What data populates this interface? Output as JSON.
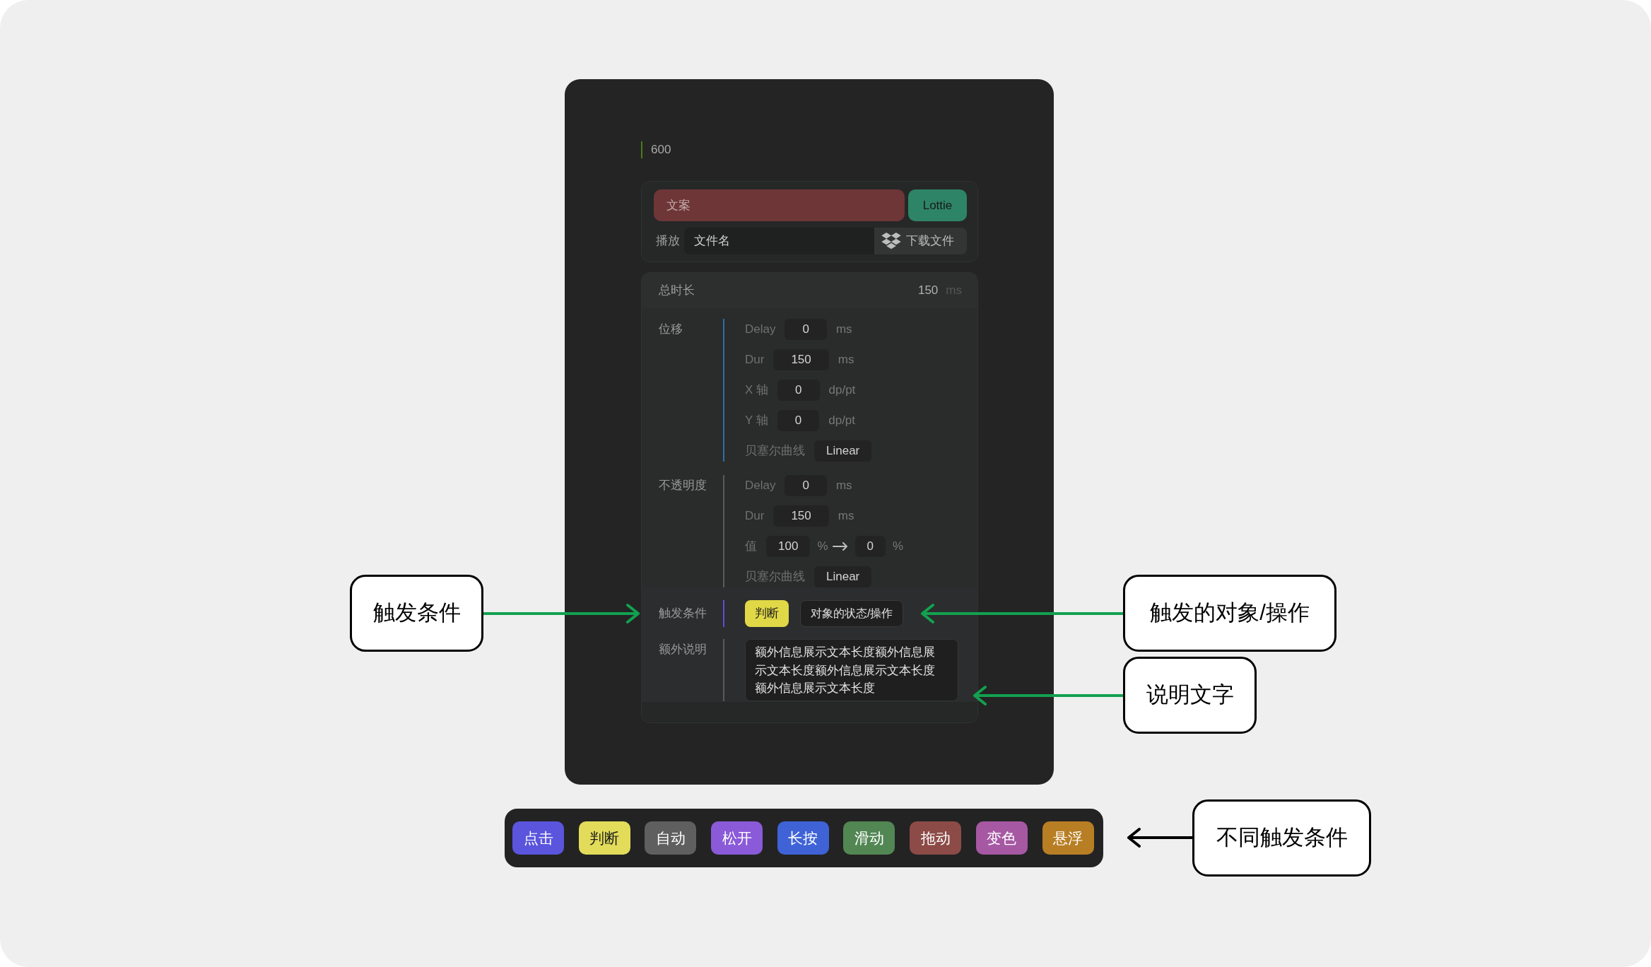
{
  "top_label": "600",
  "asset_card": {
    "copy_field": {
      "placeholder": "文案"
    },
    "lottie_button": "Lottie",
    "play_label": "播放",
    "file_field": {
      "value": "文件名"
    },
    "download_button": "下载文件"
  },
  "timing_card": {
    "total": {
      "label": "总时长",
      "value": "150",
      "unit": "ms"
    },
    "sections": [
      {
        "kind": "params",
        "label": "位移",
        "color": "#2f6fa3",
        "rows": [
          {
            "kind": "number",
            "label": "Delay",
            "value": "0",
            "unit": "ms"
          },
          {
            "kind": "number",
            "label": "Dur",
            "value": "150",
            "unit": "ms"
          },
          {
            "kind": "number",
            "label": "X 轴",
            "value": "0",
            "unit": "dp/pt"
          },
          {
            "kind": "number",
            "label": "Y 轴",
            "value": "0",
            "unit": "dp/pt"
          },
          {
            "kind": "select",
            "label": "贝塞尔曲线",
            "value": "Linear"
          }
        ]
      },
      {
        "kind": "params",
        "label": "不透明度",
        "color": "#5a5a5a",
        "rows": [
          {
            "kind": "number",
            "label": "Delay",
            "value": "0",
            "unit": "ms"
          },
          {
            "kind": "number",
            "label": "Dur",
            "value": "150",
            "unit": "ms"
          },
          {
            "kind": "range",
            "label": "值",
            "from": "100",
            "from_unit": "%",
            "to": "0",
            "to_unit": "%"
          },
          {
            "kind": "select",
            "label": "贝塞尔曲线",
            "value": "Linear"
          }
        ]
      },
      {
        "kind": "trigger",
        "label": "触发条件",
        "color": "#5b50d8",
        "tag": {
          "text": "判断",
          "color": "#e0d846"
        },
        "target": "对象的状态/操作"
      },
      {
        "kind": "note",
        "label": "额外说明",
        "color": "#5a5a5a",
        "text": "额外信息展示文本长度额外信息展示文本长度额外信息展示文本长度额外信息展示文本长度"
      }
    ]
  },
  "callouts": [
    {
      "text": "触发条件",
      "color": "#12a150"
    },
    {
      "text": "触发的对象/操作",
      "color": "#12a150"
    },
    {
      "text": "说明文字",
      "color": "#12a150"
    },
    {
      "text": "不同触发条件",
      "color": "#000000"
    }
  ],
  "trigger_types": [
    {
      "label": "点击",
      "color": "#5a55dc"
    },
    {
      "label": "判断",
      "color": "#e2dc5a"
    },
    {
      "label": "自动",
      "color": "#5f5f5f"
    },
    {
      "label": "松开",
      "color": "#8a5ad8"
    },
    {
      "label": "长按",
      "color": "#3f63d6"
    },
    {
      "label": "滑动",
      "color": "#528754"
    },
    {
      "label": "拖动",
      "color": "#8c4b47"
    },
    {
      "label": "变色",
      "color": "#a658a3"
    },
    {
      "label": "悬浮",
      "color": "#b87e24"
    }
  ]
}
